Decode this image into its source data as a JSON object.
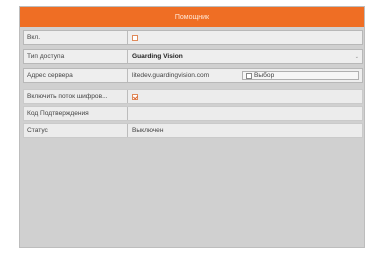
{
  "dialog": {
    "title": "Помощник"
  },
  "rows": {
    "enable": {
      "label": "Вкл.",
      "checked": false
    },
    "access_type": {
      "label": "Тип доступа",
      "value": "Guarding Vision"
    },
    "server_address": {
      "label": "Адрес сервера",
      "value": "litedev.guardingvision.com",
      "choose_label": "Выбор",
      "choose_checked": false
    },
    "stream_encryption": {
      "label": "Включить поток шифров...",
      "checked": true
    },
    "verification_code": {
      "label": "Код Подтверждения",
      "value": ""
    },
    "status": {
      "label": "Статус",
      "value": "Выключен"
    }
  },
  "colors": {
    "titlebar": "#ef6e24",
    "panel": "#d0d0d0",
    "row": "#eeeeee"
  },
  "icons": {
    "select_arrow": "chevron-down-icon"
  }
}
